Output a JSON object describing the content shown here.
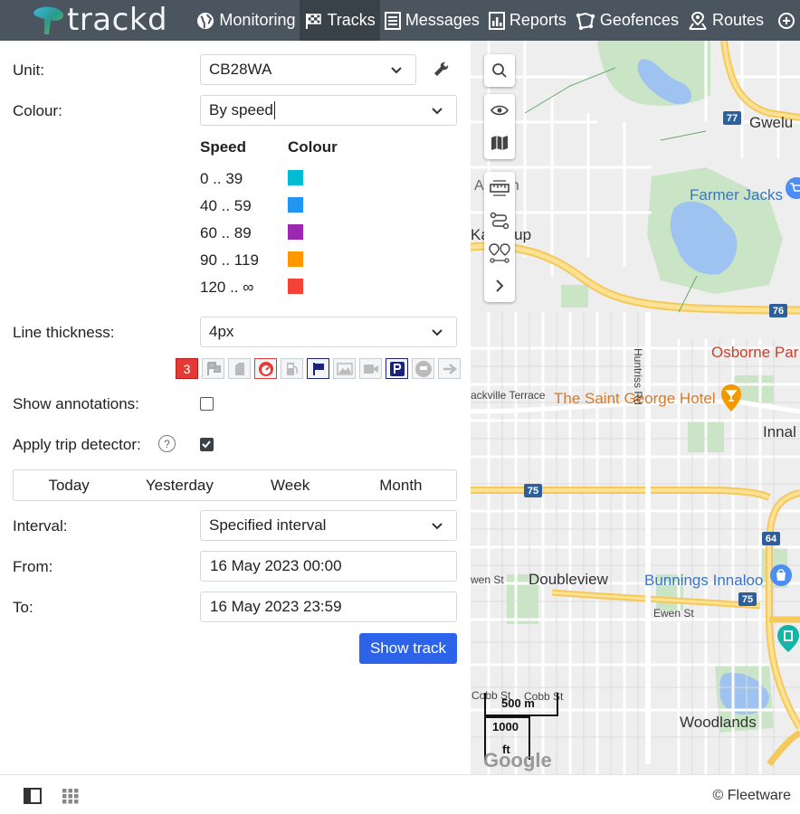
{
  "app": {
    "logo_text": "trackd"
  },
  "nav": {
    "items": [
      {
        "label": "Monitoring",
        "icon": "globe-icon"
      },
      {
        "label": "Tracks",
        "icon": "checkered-flag-icon",
        "active": true
      },
      {
        "label": "Messages",
        "icon": "list-icon"
      },
      {
        "label": "Reports",
        "icon": "report-icon"
      },
      {
        "label": "Geofences",
        "icon": "geofence-icon"
      },
      {
        "label": "Routes",
        "icon": "route-icon"
      }
    ]
  },
  "form": {
    "unit_label": "Unit:",
    "unit_value": "CB28WA",
    "colour_label": "Colour:",
    "colour_value": "By speed",
    "legend": {
      "speed_header": "Speed",
      "colour_header": "Colour",
      "rows": [
        {
          "range": "0 .. 39",
          "color": "#00bcd4"
        },
        {
          "range": "40 .. 59",
          "color": "#2196f3"
        },
        {
          "range": "60 .. 89",
          "color": "#9c27b0"
        },
        {
          "range": "90 .. 119",
          "color": "#ff9800"
        },
        {
          "range": "120 .. ∞",
          "color": "#f44336"
        }
      ]
    },
    "thickness_label": "Line thickness:",
    "thickness_value": "4px",
    "marker_badge": "3",
    "annotations_label": "Show annotations:",
    "annotations_checked": false,
    "trip_label": "Apply trip detector:",
    "trip_checked": true,
    "periods": [
      "Today",
      "Yesterday",
      "Week",
      "Month"
    ],
    "interval_label": "Interval:",
    "interval_value": "Specified interval",
    "from_label": "From:",
    "from_value": "16 May 2023 00:00",
    "to_label": "To:",
    "to_value": "16 May 2023 23:59",
    "show_button": "Show track"
  },
  "map": {
    "labels": {
      "gwelup": "Gwelu",
      "farmer_jacks": "Farmer Jacks",
      "karrinyup": "Ka    yup",
      "african": "African",
      "osborne": "Osborne Par",
      "saint_george": "The Saint George Hotel",
      "innal": "Innal",
      "sackville": "ackville Terrace",
      "huntriss": "Huntriss Rd",
      "doubleview": "Doubleview",
      "bunnings": "Bunnings Innaloo",
      "ewen_st_left": "wen St",
      "ewen_st": "Ewen St",
      "cobb_st_left": "Cobb St",
      "cobb_st": "Cobb St",
      "woodlands": "Woodlands",
      "google": "Google"
    },
    "shields": [
      "77",
      "76",
      "75",
      "64",
      "75"
    ],
    "scale_metric": "500 m",
    "scale_imperial_1": "1000",
    "scale_imperial_2": "ft"
  },
  "footer": {
    "copyright": "© Fleetware"
  }
}
